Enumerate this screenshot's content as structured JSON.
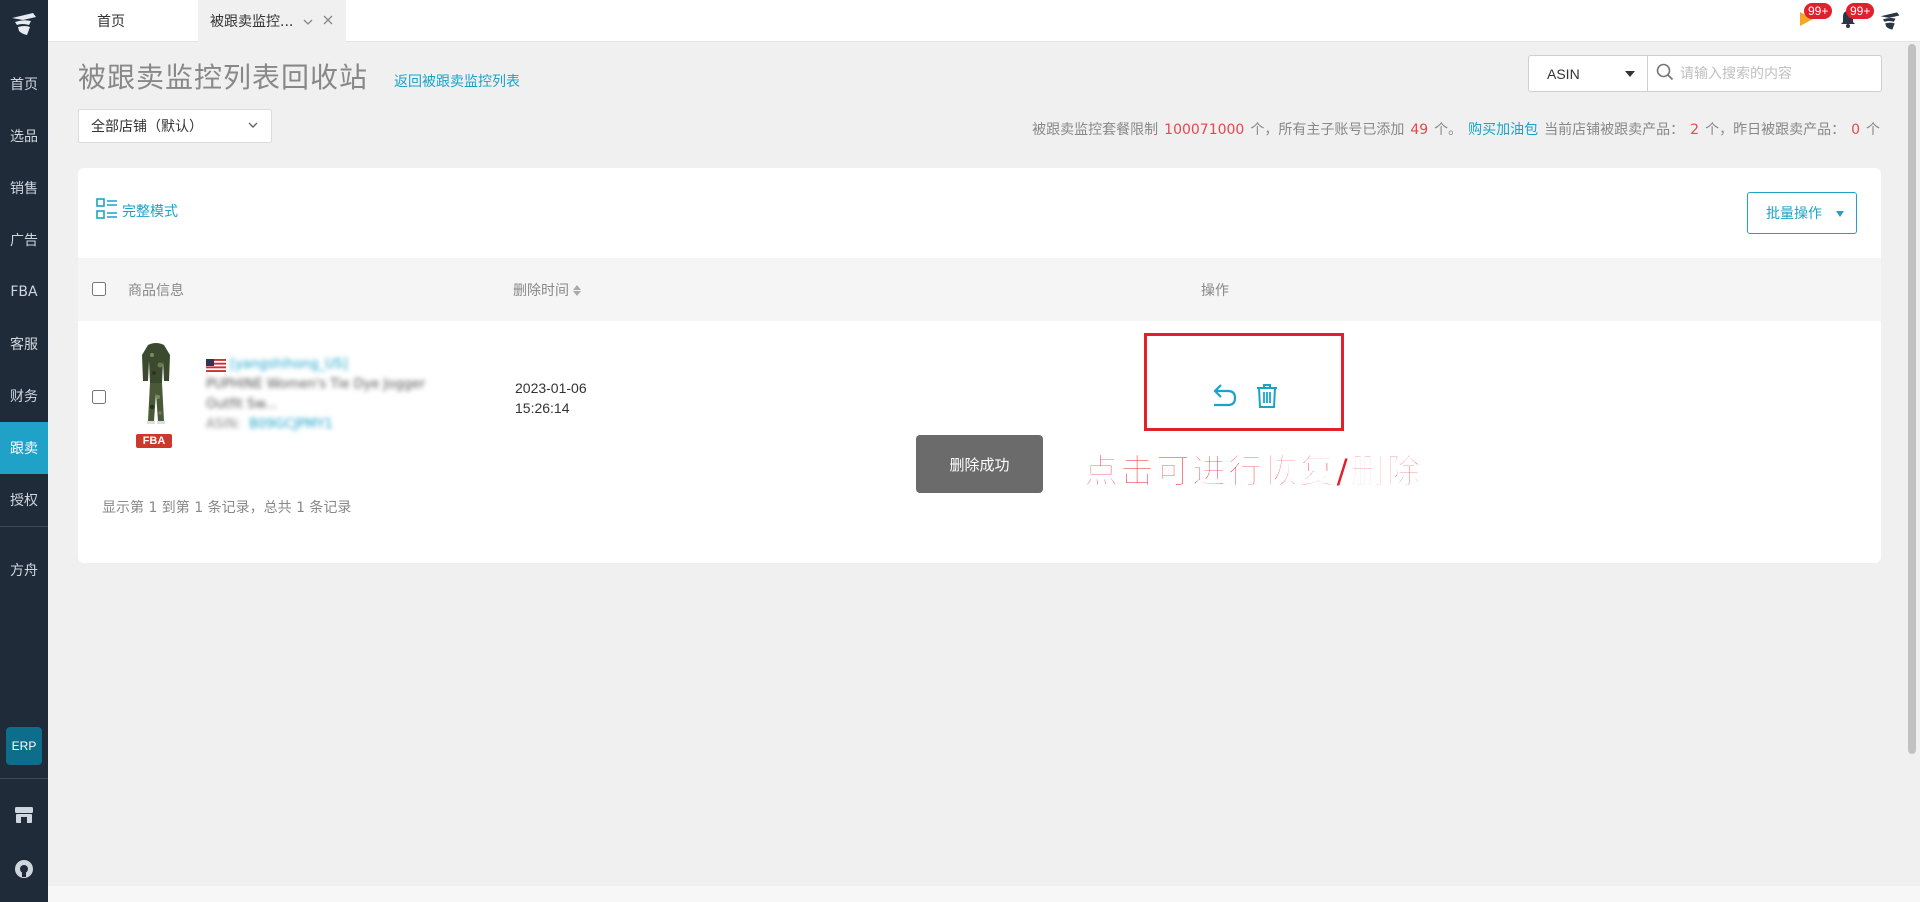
{
  "sidebar": {
    "items": [
      {
        "label": "首页"
      },
      {
        "label": "选品"
      },
      {
        "label": "销售"
      },
      {
        "label": "广告"
      },
      {
        "label": "FBA"
      },
      {
        "label": "客服"
      },
      {
        "label": "财务"
      },
      {
        "label": "跟卖",
        "active": true
      },
      {
        "label": "授权"
      },
      {
        "label": "方舟"
      }
    ],
    "erp_label": "ERP"
  },
  "tabs": {
    "home_label": "首页",
    "active_label": "被跟卖监控..."
  },
  "header": {
    "flag_badge": "99+",
    "bell_badge": "99+"
  },
  "page": {
    "title": "被跟卖监控列表回收站",
    "back_link": "返回被跟卖监控列表",
    "store_select": "全部店铺（默认）"
  },
  "search": {
    "type": "ASIN",
    "placeholder": "请输入搜索的内容"
  },
  "stats": {
    "limit_label": "被跟卖监控套餐限制",
    "limit_value": "100071000",
    "unit1": "个，所有主子账号已添加",
    "added_value": "49",
    "unit2": "个。",
    "buy_link": "购买加油包",
    "current_label": "当前店铺被跟卖产品：",
    "current_value": "2",
    "unit3": "个，昨日被跟卖产品：",
    "yesterday_value": "0",
    "unit4": "个"
  },
  "toolbar": {
    "mode_label": "完整模式",
    "batch_label": "批量操作"
  },
  "table": {
    "columns": {
      "goods": "商品信息",
      "time": "删除时间",
      "op": "操作"
    },
    "rows": [
      {
        "shop": "[yangshihong_US]",
        "title": "PUPHINE Women's Tie Dye Jogger Outfit Sw...",
        "asin_label": "ASIN:",
        "asin": "B09GCJPMY1",
        "tag": "FBA",
        "date": "2023-01-06",
        "time": "15:26:14"
      }
    ],
    "pager": "显示第 1 到第 1 条记录，总共 1 条记录"
  },
  "toast": "删除成功",
  "annotation": "点击可进行恢复/删除",
  "colors": {
    "accent": "#1aa3c9",
    "sidebar_bg": "#1f2b39",
    "highlight_red": "#e3202a"
  }
}
